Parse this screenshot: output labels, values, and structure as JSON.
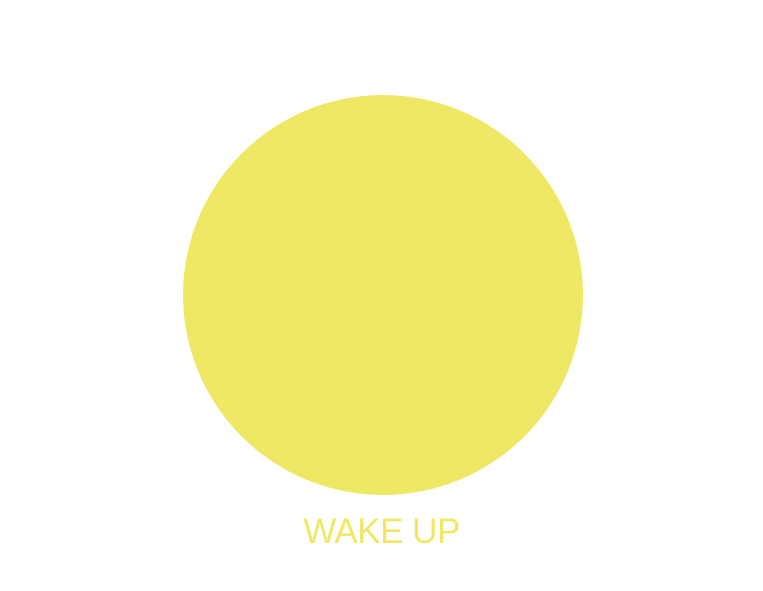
{
  "theme": {
    "accent": "#eee865",
    "background": "#ffffff"
  },
  "wake": {
    "label": "WAKE UP"
  }
}
